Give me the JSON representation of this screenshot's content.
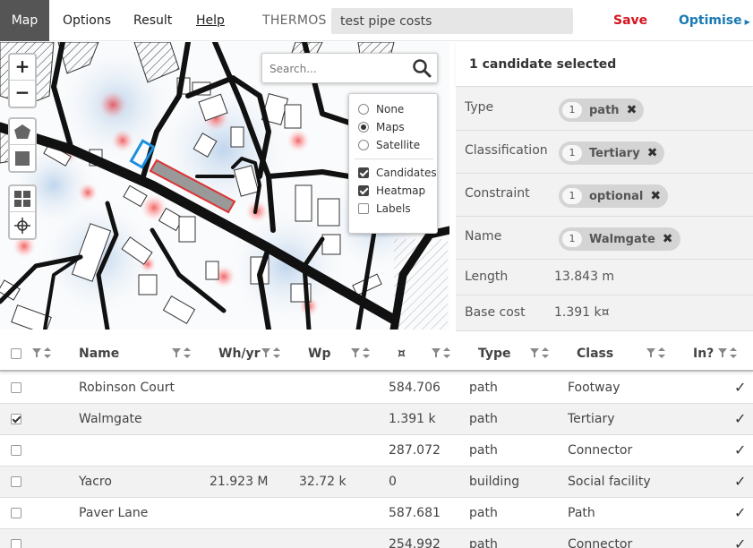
{
  "topbar": {
    "tabs": [
      {
        "label": "Map",
        "active": true
      },
      {
        "label": "Options"
      },
      {
        "label": "Result"
      },
      {
        "label": "Help"
      }
    ],
    "brand": "THERMOS",
    "project_name": "test pipe costs",
    "save_label": "Save",
    "optimise_label": "Optimise",
    "colors": {
      "save": "#d4141e",
      "optimise": "#1a7ab4",
      "active_tab": "#555555"
    }
  },
  "map": {
    "zoom_in": "+",
    "zoom_out": "−",
    "search_placeholder": "Search...",
    "layers": {
      "base": [
        {
          "label": "None",
          "selected": false
        },
        {
          "label": "Maps",
          "selected": true
        },
        {
          "label": "Satellite",
          "selected": false
        }
      ],
      "overlays": [
        {
          "label": "Candidates",
          "checked": true
        },
        {
          "label": "Heatmap",
          "checked": true
        },
        {
          "label": "Labels",
          "checked": false
        }
      ]
    },
    "icons": [
      "search-icon",
      "polygon-icon",
      "rectangle-icon",
      "grid-icon",
      "crosshair-icon"
    ]
  },
  "panel": {
    "header": "1 candidate selected",
    "rows": [
      {
        "label": "Type",
        "chip": {
          "count": "1",
          "value": "path"
        }
      },
      {
        "label": "Classification",
        "chip": {
          "count": "1",
          "value": "Tertiary"
        }
      },
      {
        "label": "Constraint",
        "chip": {
          "count": "1",
          "value": "optional"
        }
      },
      {
        "label": "Name",
        "chip": {
          "count": "1",
          "value": "Walmgate"
        }
      },
      {
        "label": "Length",
        "value": "13.843 m"
      },
      {
        "label": "Base cost",
        "value": "1.391 k¤"
      }
    ]
  },
  "table": {
    "headers": {
      "name": "Name",
      "whyr": "Wh/yr",
      "wp": "Wp",
      "cost": "¤",
      "type": "Type",
      "class": "Class",
      "in": "In?"
    },
    "rows": [
      {
        "checked": false,
        "name": "Robinson Court",
        "whyr": "",
        "wp": "",
        "cost": "584.706",
        "type": "path",
        "class": "Footway",
        "in": "✓"
      },
      {
        "checked": true,
        "name": "Walmgate",
        "whyr": "",
        "wp": "",
        "cost": "1.391 k",
        "type": "path",
        "class": "Tertiary",
        "in": "✓"
      },
      {
        "checked": false,
        "name": "",
        "whyr": "",
        "wp": "",
        "cost": "287.072",
        "type": "path",
        "class": "Connector",
        "in": "✓"
      },
      {
        "checked": false,
        "name": "Yacro",
        "whyr": "21.923 M",
        "wp": "32.72 k",
        "cost": "0",
        "type": "building",
        "class": "Social facility",
        "in": "✓"
      },
      {
        "checked": false,
        "name": "Paver Lane",
        "whyr": "",
        "wp": "",
        "cost": "587.681",
        "type": "path",
        "class": "Path",
        "in": "✓"
      },
      {
        "checked": false,
        "name": "",
        "whyr": "",
        "wp": "",
        "cost": "254.992",
        "type": "path",
        "class": "Connector",
        "in": "✓"
      }
    ]
  }
}
